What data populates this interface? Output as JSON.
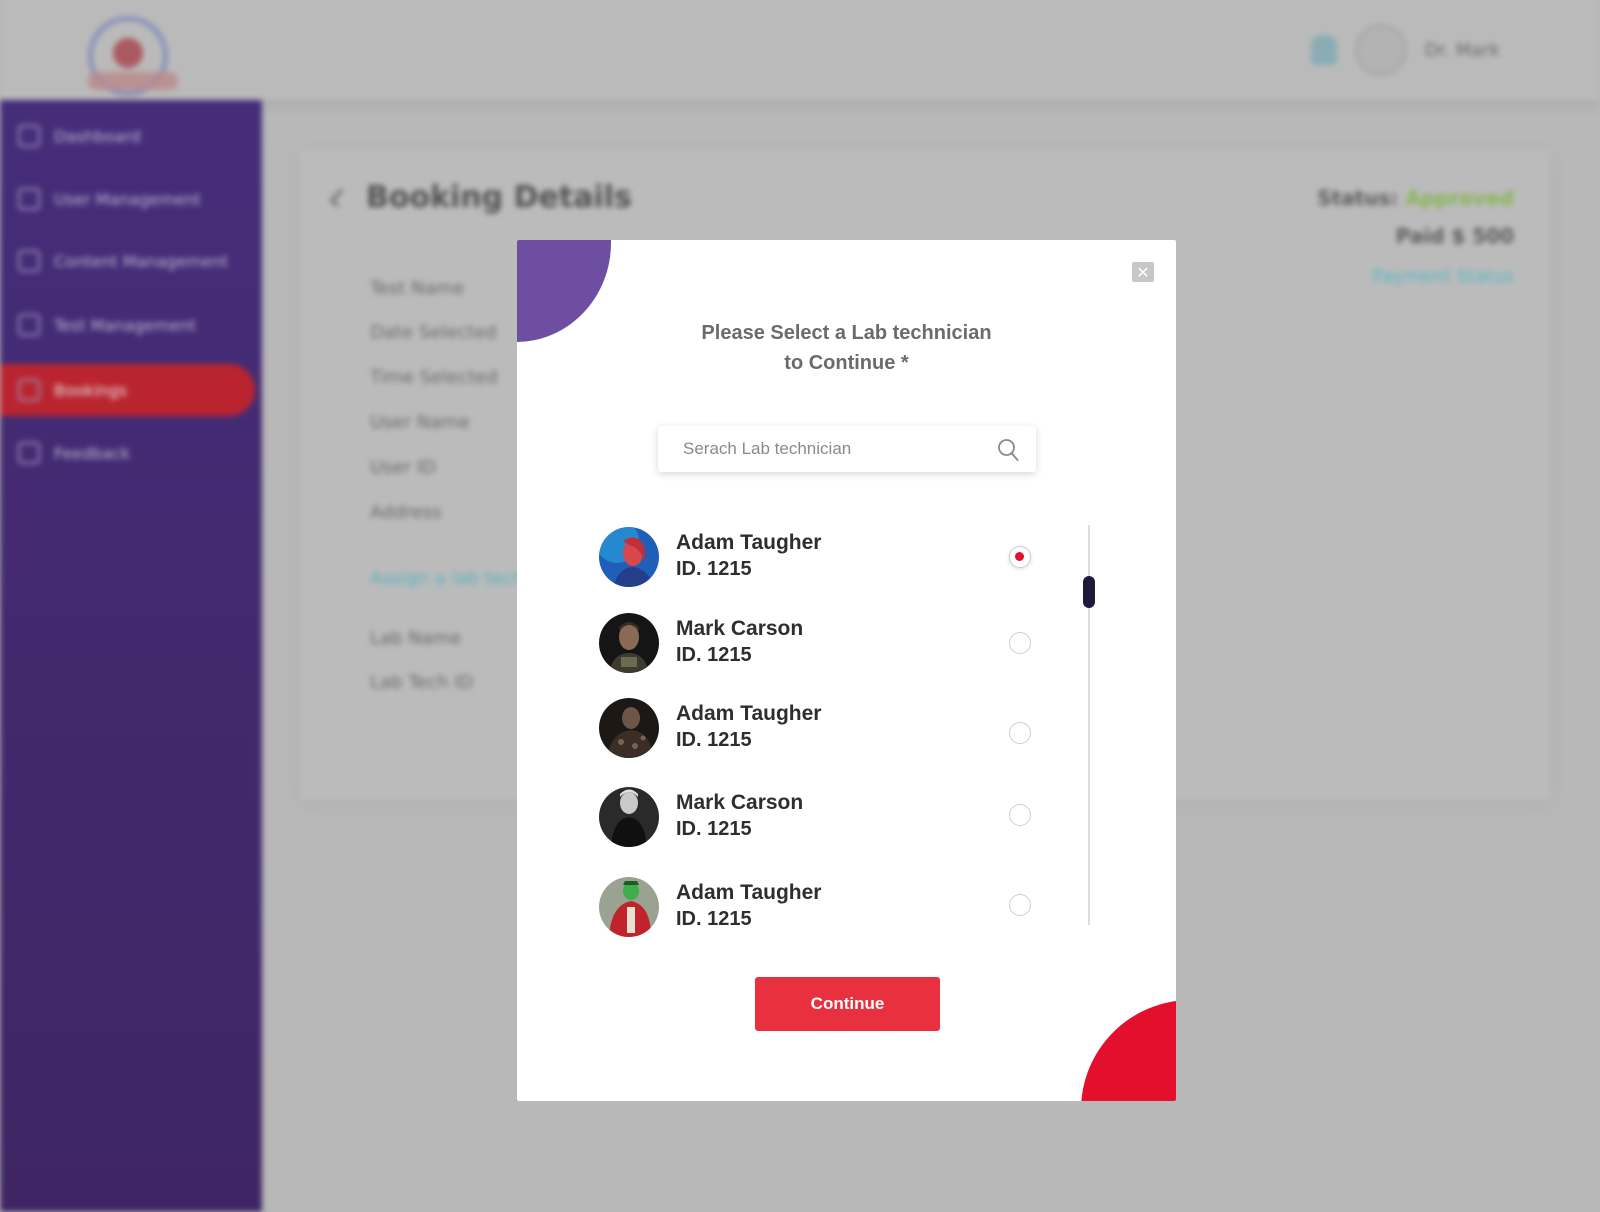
{
  "background": {
    "sidebar": {
      "items": [
        {
          "label": "Dashboard",
          "icon": "grid-icon",
          "active": false
        },
        {
          "label": "User Management",
          "icon": "users-icon",
          "active": false
        },
        {
          "label": "Content Management",
          "icon": "document-icon",
          "active": false
        },
        {
          "label": "Test Management",
          "icon": "flask-icon",
          "active": false
        },
        {
          "label": "Bookings",
          "icon": "calendar-icon",
          "active": true
        },
        {
          "label": "Feedback",
          "icon": "chat-icon",
          "active": false
        }
      ]
    },
    "header": {
      "user_name": "Dr. Mark"
    },
    "page": {
      "title": "Booking Details",
      "status_label": "Status:",
      "status_value": "Approved",
      "status_color": "#8bc34a",
      "amount": "Paid $ 500",
      "payment_link": "Payment Status",
      "fields": [
        "Test Name",
        "Date Selected",
        "Time Selected",
        "User Name",
        "User ID",
        "Address",
        "Assign a lab technician",
        "Lab Name",
        "Lab Tech ID"
      ]
    }
  },
  "modal": {
    "title_line1": "Please Select a Lab technician",
    "title_line2": "to Continue *",
    "close_icon": "close-icon",
    "search": {
      "placeholder": "Serach Lab technician",
      "value": "",
      "icon": "search-icon"
    },
    "technicians": [
      {
        "name": "Adam Taugher",
        "id": "ID. 1215",
        "selected": true
      },
      {
        "name": "Mark Carson",
        "id": "ID. 1215",
        "selected": false
      },
      {
        "name": "Adam Taugher",
        "id": "ID. 1215",
        "selected": false
      },
      {
        "name": "Mark Carson",
        "id": "ID. 1215",
        "selected": false
      },
      {
        "name": "Adam Taugher",
        "id": "ID. 1215",
        "selected": false
      }
    ],
    "continue_label": "Continue",
    "colors": {
      "accent_red": "#e30f2d",
      "button_red": "#e8303f",
      "accent_purple": "#6e4ea0",
      "sidebar_purple": "#3a1d7a"
    }
  }
}
